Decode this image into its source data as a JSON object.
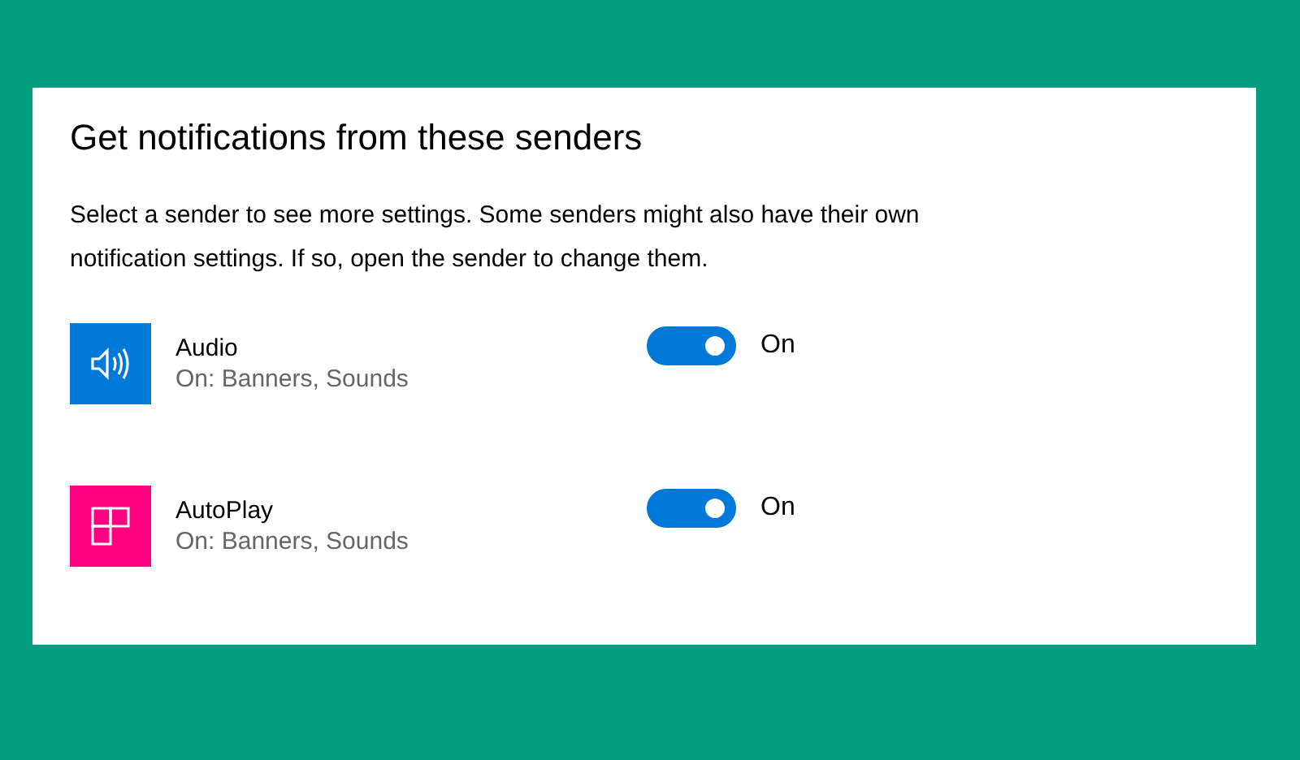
{
  "title": "Get notifications from these senders",
  "description": "Select a sender to see more settings. Some senders might also have their own notification settings. If so, open the sender to change them.",
  "senders": [
    {
      "name": "Audio",
      "status": "On: Banners, Sounds",
      "kind": "speaker",
      "color": "#0078d7",
      "on": true,
      "toggle_label": "On"
    },
    {
      "name": "AutoPlay",
      "status": "On: Banners, Sounds",
      "kind": "tiles",
      "color": "#ff0080",
      "on": true,
      "toggle_label": "On"
    }
  ]
}
